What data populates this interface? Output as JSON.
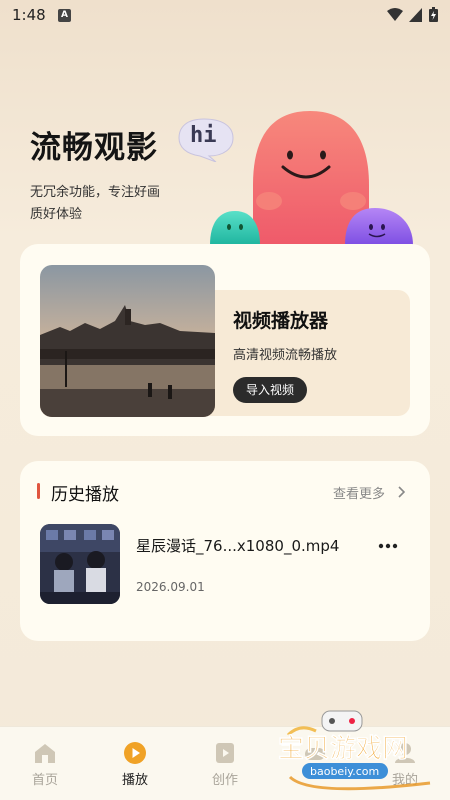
{
  "status_bar": {
    "time": "1:48",
    "badge": "A"
  },
  "hero": {
    "title": "流畅观影",
    "bubble_text": "hi",
    "subtitle_line1": "无冗余功能，专注好画",
    "subtitle_line2": "质好体验"
  },
  "player_card": {
    "title": "视频播放器",
    "description": "高清视频流畅播放",
    "import_button": "导入视频"
  },
  "history": {
    "title": "历史播放",
    "more_label": "查看更多",
    "items": [
      {
        "name": "星辰漫话_76...x1080_0.mp4",
        "date": "2026.09.01"
      }
    ]
  },
  "nav": {
    "items": [
      {
        "label": "首页",
        "icon": "home-icon",
        "active": false
      },
      {
        "label": "播放",
        "icon": "play-icon",
        "active": true
      },
      {
        "label": "创作",
        "icon": "create-icon",
        "active": false
      },
      {
        "label": "",
        "icon": "gamepad-icon",
        "active": false
      },
      {
        "label": "我的",
        "icon": "profile-icon",
        "active": false
      }
    ]
  },
  "watermark": {
    "text": "宝贝游戏网",
    "url": "baobeiy.com"
  },
  "colors": {
    "accent": "#f0a226",
    "history_bar": "#e0553f",
    "button_dark": "#2b2b2b"
  }
}
